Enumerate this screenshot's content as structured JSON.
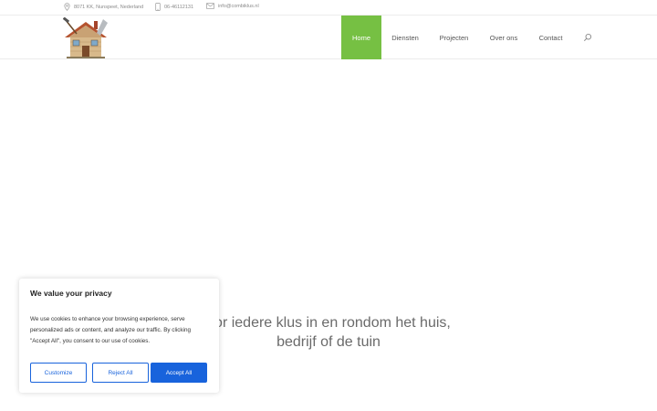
{
  "topbar": {
    "address": "8071 KK, Nunspeet, Nederland",
    "phone": "06-46112131",
    "email": "info@combiklus.nl",
    "icons": [
      "location-pin-icon",
      "phone-icon",
      "mail-icon"
    ]
  },
  "nav": {
    "items": [
      {
        "label": "Home",
        "active": true
      },
      {
        "label": "Diensten",
        "active": false
      },
      {
        "label": "Projecten",
        "active": false
      },
      {
        "label": "Over ons",
        "active": false
      },
      {
        "label": "Contact",
        "active": false
      }
    ]
  },
  "hero": {
    "line1": "oor iedere klus in en rondom het huis,",
    "line2": "bedrijf of de tuin"
  },
  "cookie": {
    "title": "We value your privacy",
    "description": "We use cookies to enhance your browsing experience, serve personalized ads or content, and analyze our traffic. By clicking \"Accept All\", you consent to our use of cookies.",
    "customize_label": "Customize",
    "reject_label": "Reject All",
    "accept_label": "Accept All"
  },
  "colors": {
    "accent": "#76c043",
    "cookie_button": "#1863dc"
  }
}
